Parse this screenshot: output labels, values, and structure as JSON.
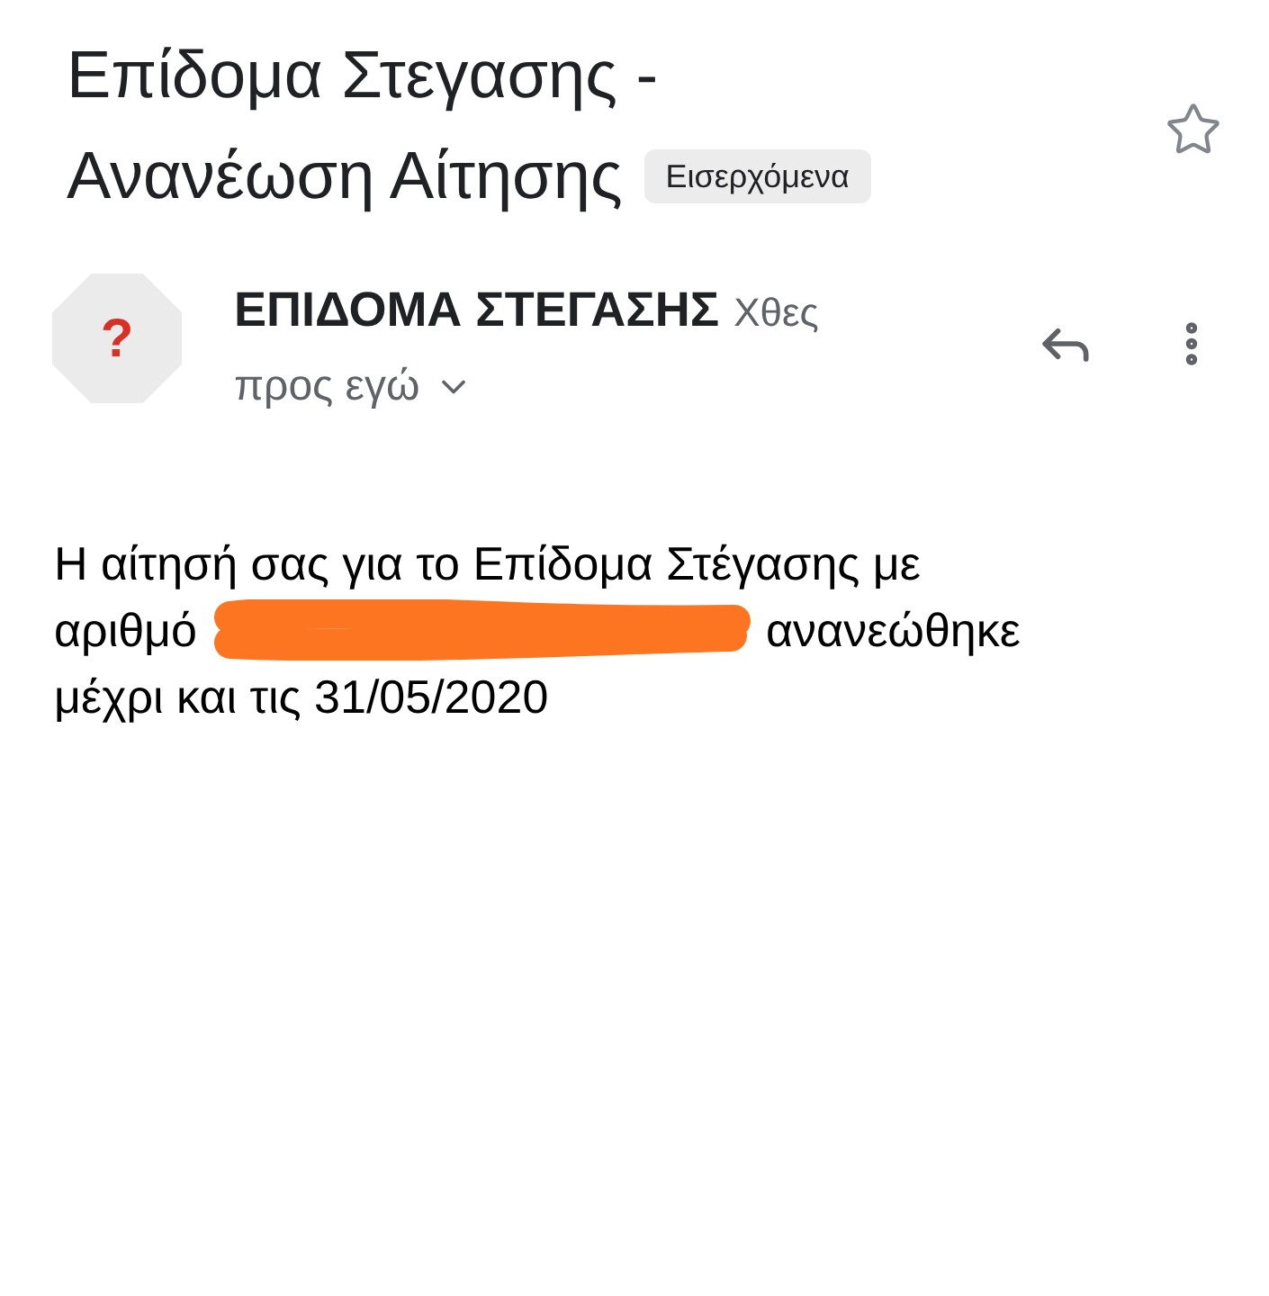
{
  "subject_lines": [
    "Επίδομα Στεγασης -",
    "Ανανέωση Αίτησης"
  ],
  "label": "Εισερχόμενα",
  "starred": false,
  "sender": {
    "avatar": "?",
    "name": "ΕΠΙΔΟΜΑ ΣΤΕΓΑΣΗΣ",
    "time": "Χθες",
    "recipient": "προς εγώ"
  },
  "body": {
    "line_1": "Η αίτησή σας για το Επίδομα Στέγασης με",
    "before": "αριθμό",
    "redacted": true,
    "after": "ανανεώθηκε",
    "line_3": "μέχρι και τις 31/05/2020"
  }
}
